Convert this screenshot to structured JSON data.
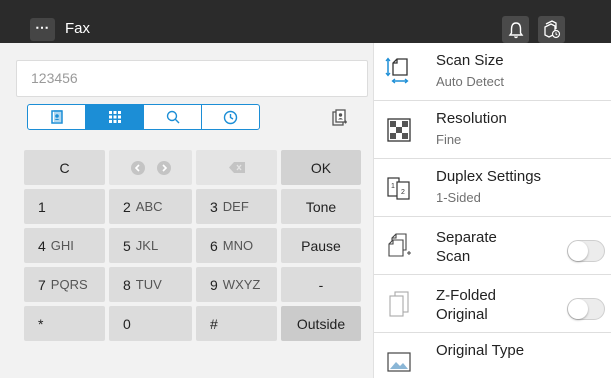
{
  "header": {
    "menu_label": "⋯",
    "title": "Fax",
    "icons": [
      "menu-icon",
      "bell-icon",
      "job-list-icon"
    ]
  },
  "destination": {
    "value": "123456"
  },
  "tabs": [
    {
      "name": "address-book-tab",
      "icon": "address-book-icon",
      "active": false
    },
    {
      "name": "keypad-tab",
      "icon": "keypad-icon",
      "active": true
    },
    {
      "name": "search-tab",
      "icon": "search-icon",
      "active": false
    },
    {
      "name": "history-tab",
      "icon": "clock-icon",
      "active": false
    }
  ],
  "keypad": {
    "clear": "C",
    "ok": "OK",
    "rows": [
      {
        "num": "1",
        "letters": ""
      },
      {
        "num": "2",
        "letters": "ABC"
      },
      {
        "num": "3",
        "letters": "DEF"
      },
      {
        "func": "Tone"
      },
      {
        "num": "4",
        "letters": "GHI"
      },
      {
        "num": "5",
        "letters": "JKL"
      },
      {
        "num": "6",
        "letters": "MNO"
      },
      {
        "func": "Pause"
      },
      {
        "num": "7",
        "letters": "PQRS"
      },
      {
        "num": "8",
        "letters": "TUV"
      },
      {
        "num": "9",
        "letters": "WXYZ"
      },
      {
        "func": "-"
      },
      {
        "num": "*",
        "letters": ""
      },
      {
        "num": "0",
        "letters": ""
      },
      {
        "num": "#",
        "letters": ""
      },
      {
        "func": "Outside"
      }
    ]
  },
  "settings": [
    {
      "title": "Scan Size",
      "value": "Auto Detect",
      "icon": "scan-size-icon"
    },
    {
      "title": "Resolution",
      "value": "Fine",
      "icon": "resolution-icon"
    },
    {
      "title": "Duplex Settings",
      "value": "1-Sided",
      "icon": "duplex-icon"
    },
    {
      "title": "Separate\nScan",
      "value": "",
      "icon": "separate-scan-icon",
      "toggle": false
    },
    {
      "title": "Z-Folded\nOriginal",
      "value": "",
      "icon": "z-folded-icon",
      "toggle": false
    },
    {
      "title": "Original Type",
      "value": "",
      "icon": "original-type-icon"
    }
  ],
  "colors": {
    "header_bg": "#2b2b2b",
    "accent": "#1c8ed6",
    "key_bg": "#dcdcdc",
    "panel_bg": "#f2f2f2"
  }
}
